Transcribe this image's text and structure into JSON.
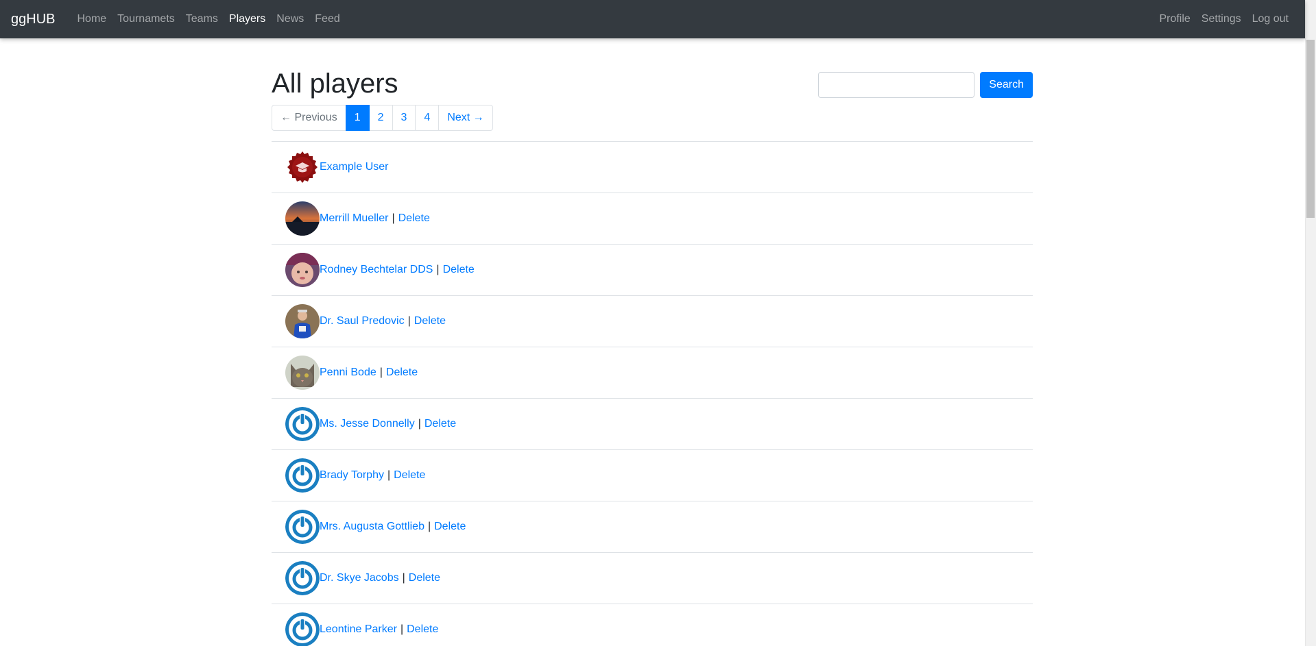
{
  "nav": {
    "brand": "ggHUB",
    "links": [
      "Home",
      "Tournamets",
      "Teams",
      "Players",
      "News",
      "Feed"
    ],
    "right_links": [
      "Profile",
      "Settings",
      "Log out"
    ]
  },
  "page": {
    "title": "All players",
    "search_placeholder": "",
    "search_button": "Search"
  },
  "pagination": {
    "prev": "← Previous",
    "pages": [
      "1",
      "2",
      "3",
      "4"
    ],
    "current": "1",
    "next": "Next →"
  },
  "separator": "|",
  "delete_label": "Delete",
  "players": [
    {
      "name": "Example User",
      "avatar": "badge-avatar",
      "deletable": false
    },
    {
      "name": "Merrill Mueller",
      "avatar": "sunset-photo-avatar",
      "deletable": true
    },
    {
      "name": "Rodney Bechtelar DDS",
      "avatar": "baby-photo-avatar",
      "deletable": true
    },
    {
      "name": "Dr. Saul Predovic",
      "avatar": "person-photo-avatar",
      "deletable": true
    },
    {
      "name": "Penni Bode",
      "avatar": "cat-photo-avatar",
      "deletable": true
    },
    {
      "name": "Ms. Jesse Donnelly",
      "avatar": "power-icon-avatar",
      "deletable": true
    },
    {
      "name": "Brady Torphy",
      "avatar": "power-icon-avatar",
      "deletable": true
    },
    {
      "name": "Mrs. Augusta Gottlieb",
      "avatar": "power-icon-avatar",
      "deletable": true
    },
    {
      "name": "Dr. Skye Jacobs",
      "avatar": "power-icon-avatar",
      "deletable": true
    },
    {
      "name": "Leontine Parker",
      "avatar": "power-icon-avatar",
      "deletable": true
    }
  ],
  "colors": {
    "navbar": "#343a40",
    "link": "#007bff",
    "power_icon": "#1a7fc1"
  }
}
